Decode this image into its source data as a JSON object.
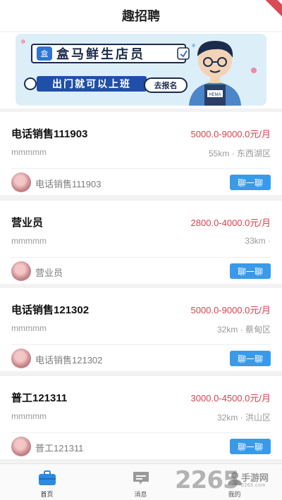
{
  "header": {
    "title": "趣招聘"
  },
  "banner": {
    "title": "盒马鲜生店员",
    "icon_text": "盒",
    "subtitle": "出门就可以上班",
    "button_label": "去报名",
    "badge_text": "HEMA"
  },
  "jobs": [
    {
      "title": "电话销售111903",
      "salary": "5000.0-9000.0元/月",
      "company": "mmmmm",
      "distance": "55km · 东西湖区",
      "poster": "电话销售111903",
      "chat_label": "聊一聊"
    },
    {
      "title": "营业员",
      "salary": "2800.0-4000.0元/月",
      "company": "mmmmm",
      "distance": "33km ·",
      "poster": "营业员",
      "chat_label": "聊一聊"
    },
    {
      "title": "电话销售121302",
      "salary": "5000.0-9000.0元/月",
      "company": "mmmmm",
      "distance": "32km · 蔡甸区",
      "poster": "电话销售121302",
      "chat_label": "聊一聊"
    },
    {
      "title": "普工121311",
      "salary": "3000.0-4500.0元/月",
      "company": "mmmmm",
      "distance": "32km · 洪山区",
      "poster": "普工121311",
      "chat_label": "聊一聊"
    }
  ],
  "tabs": [
    {
      "label": "首页",
      "icon": "briefcase-icon",
      "active": true
    },
    {
      "label": "消息",
      "icon": "message-icon",
      "active": false
    },
    {
      "label": "我的",
      "icon": "person-icon",
      "active": false
    }
  ],
  "watermark": {
    "big": "2265",
    "small": "手游网",
    "sub": "2265.com"
  },
  "colors": {
    "accent": "#3a9ae8",
    "salary": "#d9424f",
    "ribbon": "#d94a55"
  }
}
